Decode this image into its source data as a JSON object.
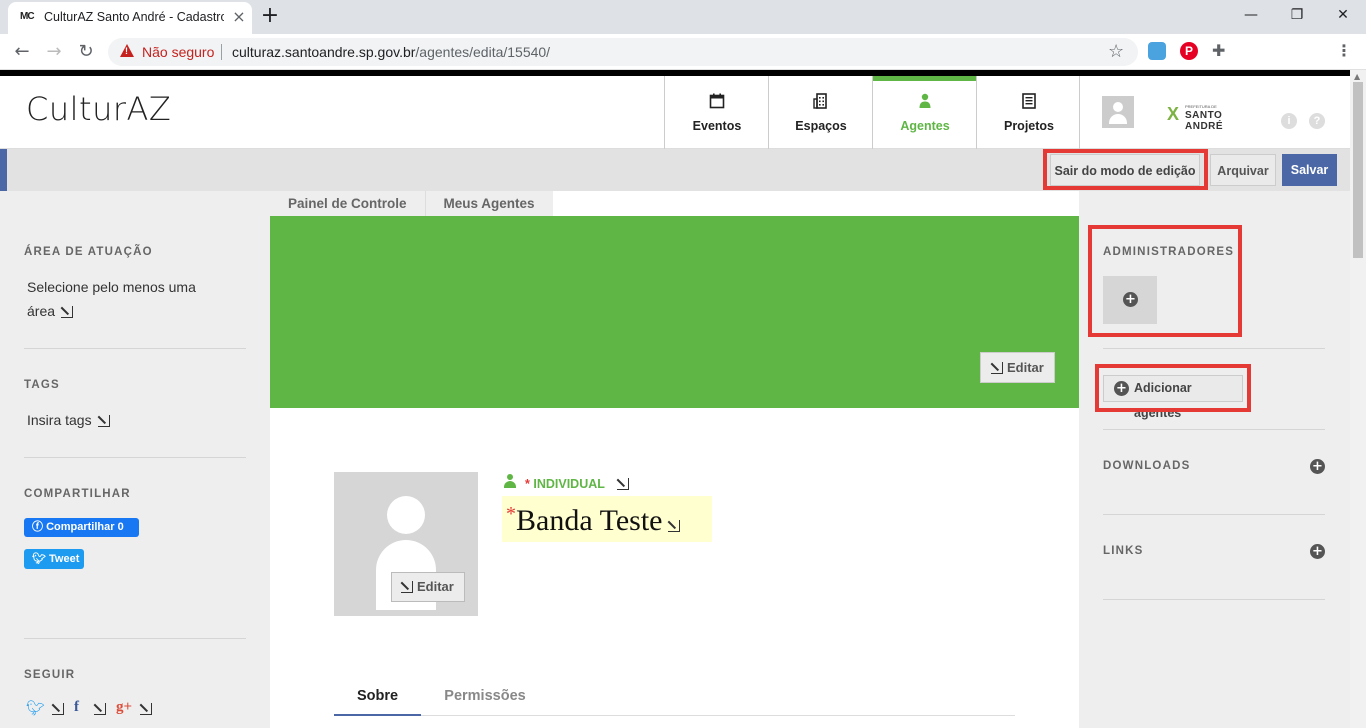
{
  "browser": {
    "tab_favicon": "MC",
    "tab_title": "CulturAZ Santo André - Cadastro",
    "address_warning": "Não seguro",
    "url_host": "culturaz.santoandre.sp.gov.br",
    "url_path": "/agentes/edita/15540/"
  },
  "header": {
    "logo": "CulturAZ",
    "nav": [
      {
        "label": "Eventos",
        "icon": "calendar-icon"
      },
      {
        "label": "Espaços",
        "icon": "building-icon"
      },
      {
        "label": "Agentes",
        "icon": "person-icon"
      },
      {
        "label": "Projetos",
        "icon": "document-icon"
      }
    ],
    "active_nav": "Agentes",
    "prefeitura_small": "PREFEITURA DE",
    "prefeitura_name": "SANTO ANDRÉ"
  },
  "editbar": {
    "exit_label": "Sair do modo de edição",
    "archive_label": "Arquivar",
    "save_label": "Salvar"
  },
  "breadcrumb": [
    "Painel de Controle",
    "Meus Agentes"
  ],
  "cover": {
    "edit_label": "Editar"
  },
  "profile": {
    "avatar_edit_label": "Editar",
    "type_label": "INDIVIDUAL",
    "name": "Banda Teste",
    "required_mark": "*"
  },
  "tabs": [
    "Sobre",
    "Permissões"
  ],
  "sidebar_left": {
    "area_title": "ÁREA DE ATUAÇÃO",
    "area_line1": "Selecione pelo menos uma",
    "area_line2": "área",
    "tags_title": "TAGS",
    "tags_placeholder": "Insira tags",
    "share_title": "COMPARTILHAR",
    "fb_share": "Compartilhar 0",
    "tweet": "Tweet",
    "follow_title": "SEGUIR"
  },
  "sidebar_right": {
    "admins_title": "ADMINISTRADORES",
    "add_agents": "Adicionar agentes",
    "downloads_title": "DOWNLOADS",
    "links_title": "LINKS"
  },
  "colors": {
    "brand_green": "#5fb645",
    "brand_blue": "#4c67a6",
    "highlight_red": "#e53935"
  }
}
